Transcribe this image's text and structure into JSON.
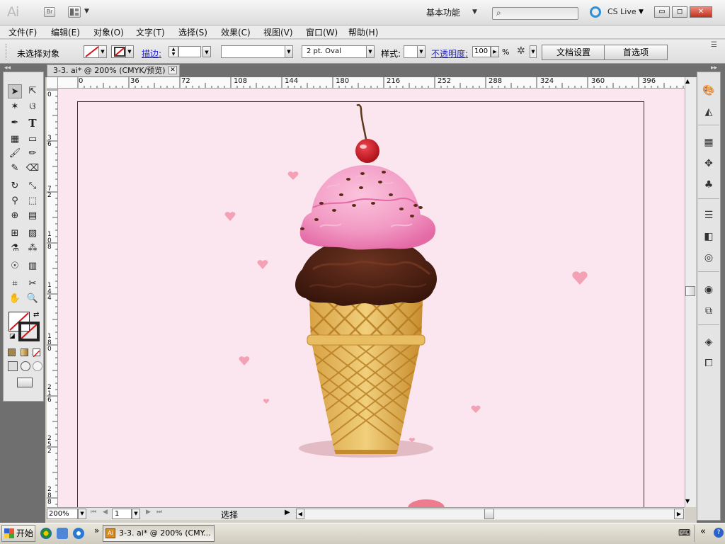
{
  "app": {
    "logo": "Ai",
    "bridge": "Br",
    "workspace": "基本功能",
    "cs_live": "CS Live"
  },
  "window_controls": {
    "minimize": "▭",
    "restore": "◻",
    "close": "✕"
  },
  "menu": [
    "文件(F)",
    "编辑(E)",
    "对象(O)",
    "文字(T)",
    "选择(S)",
    "效果(C)",
    "视图(V)",
    "窗口(W)",
    "帮助(H)"
  ],
  "control": {
    "selection_status": "未选择对象",
    "stroke_label": "描边:",
    "brush": "2 pt. Oval",
    "style_label": "样式:",
    "opacity_label": "不透明度:",
    "opacity_value": "100",
    "percent": "%",
    "doc_setup": "文档设置",
    "preferences": "首选项"
  },
  "document": {
    "tab_title": "3-3. ai* @ 200% (CMYK/预览)"
  },
  "rulers": {
    "horizontal": [
      "0",
      "36",
      "72",
      "108",
      "144",
      "180",
      "216",
      "252",
      "288",
      "324",
      "360",
      "396"
    ],
    "vertical": [
      "0",
      "36",
      "72",
      "108",
      "144",
      "180",
      "216",
      "252",
      "288"
    ]
  },
  "status_bar": {
    "zoom": "200%",
    "page": "1",
    "status_text": "选择"
  },
  "taskbar": {
    "start": "开始",
    "task_item": "3-3. ai* @ 200% (CMY..."
  },
  "colors": {
    "canvas": "#fbe5ee",
    "pink_scoop": "#f29ac4",
    "chocolate": "#4a1f10",
    "cone": "#e4b55c",
    "cherry": "#c3141c"
  },
  "icons": [
    "selection-tool",
    "direct-selection-tool",
    "magic-wand-tool",
    "lasso-tool",
    "pen-tool",
    "type-tool",
    "line-tool",
    "rectangle-tool",
    "paintbrush-tool",
    "pencil-tool",
    "blob-brush-tool",
    "eraser-tool",
    "rotate-tool",
    "scale-tool",
    "warp-tool",
    "free-transform-tool",
    "shape-builder-tool",
    "perspective-grid-tool",
    "mesh-tool",
    "gradient-tool",
    "eyedropper-tool",
    "blend-tool",
    "symbol-sprayer-tool",
    "column-graph-tool",
    "artboard-tool",
    "slice-tool",
    "hand-tool",
    "zoom-tool"
  ]
}
